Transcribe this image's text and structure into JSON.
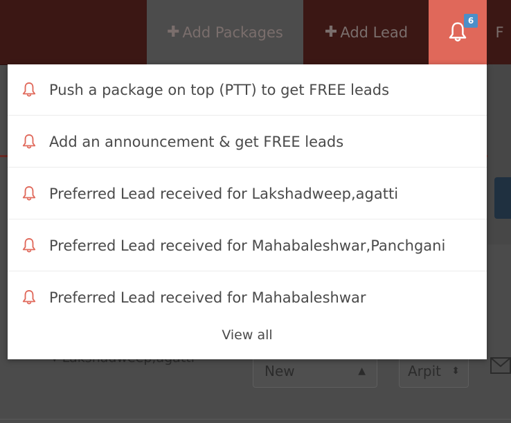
{
  "nav": {
    "add_packages": "Add Packages",
    "add_lead": "Add Lead",
    "notification_count": "6",
    "more_initial": "F"
  },
  "notifications": {
    "items": [
      {
        "text": "Push a package on top (PTT) to get FREE leads",
        "icon": "bell-icon"
      },
      {
        "text": "Add an announcement & get FREE leads",
        "icon": "bell-icon"
      },
      {
        "text": "Preferred Lead received for Lakshadweep,agatti",
        "icon": "bell-icon"
      },
      {
        "text": "Preferred Lead received for Mahabaleshwar,Panchgani",
        "icon": "bell-icon"
      },
      {
        "text": "Preferred Lead received for Mahabaleshwar",
        "icon": "bell-icon"
      }
    ],
    "view_all": "View all"
  },
  "background": {
    "lead_destination": "Lakshadweep,agatti",
    "status_value": "New",
    "user_value": "Arpit"
  },
  "colors": {
    "accent": "#e0685a",
    "nav_dark": "#3b1714",
    "badge": "#4b8fc8",
    "bell_icon": "#e0685a"
  }
}
